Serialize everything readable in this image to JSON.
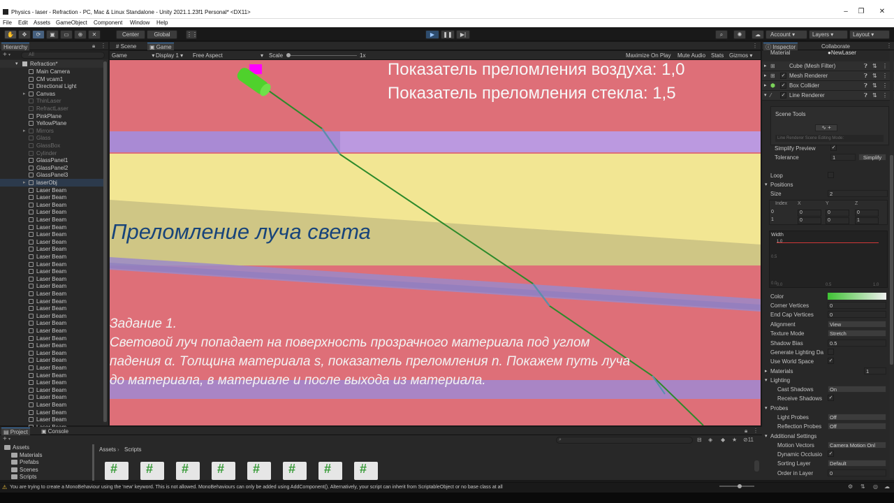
{
  "window": {
    "title": "Physics - laser - Refraction - PC, Mac & Linux Standalone - Unity 2021.1.23f1 Personal* <DX11>",
    "min": "–",
    "max": "❐",
    "close": "✕"
  },
  "menu": [
    "File",
    "Edit",
    "Assets",
    "GameObject",
    "Component",
    "Window",
    "Help"
  ],
  "toolbar": {
    "pivot_center": "Center",
    "pivot_global": "Global",
    "account": "Account",
    "layers": "Layers",
    "layout": "Layout"
  },
  "hierarchy": {
    "tab": "Hierarchy",
    "search_placeholder": "All",
    "scene": "Refraction*",
    "items": [
      {
        "label": "Main Camera",
        "dim": false,
        "arrow": ""
      },
      {
        "label": "CM vcam1",
        "dim": false,
        "arrow": ""
      },
      {
        "label": "Directional Light",
        "dim": false,
        "arrow": ""
      },
      {
        "label": "Canvas",
        "dim": false,
        "arrow": "▸"
      },
      {
        "label": "ThinLaser",
        "dim": true,
        "arrow": ""
      },
      {
        "label": "RefractLaser",
        "dim": true,
        "arrow": ""
      },
      {
        "label": "PinkPlane",
        "dim": false,
        "arrow": ""
      },
      {
        "label": "YellowPlane",
        "dim": false,
        "arrow": ""
      },
      {
        "label": "Mirrors",
        "dim": true,
        "arrow": "▸"
      },
      {
        "label": "Glass",
        "dim": true,
        "arrow": ""
      },
      {
        "label": "GlassBox",
        "dim": true,
        "arrow": ""
      },
      {
        "label": "Cylinder",
        "dim": true,
        "arrow": ""
      },
      {
        "label": "GlassPanel1",
        "dim": false,
        "arrow": ""
      },
      {
        "label": "GlassPanel2",
        "dim": false,
        "arrow": ""
      },
      {
        "label": "GlassPanel3",
        "dim": false,
        "arrow": ""
      },
      {
        "label": "laserObj",
        "dim": false,
        "arrow": "▸",
        "selected": true
      },
      {
        "label": "Laser Beam",
        "dim": false,
        "arrow": ""
      },
      {
        "label": "Laser Beam",
        "dim": false,
        "arrow": ""
      },
      {
        "label": "Laser Beam",
        "dim": false,
        "arrow": ""
      },
      {
        "label": "Laser Beam",
        "dim": false,
        "arrow": ""
      },
      {
        "label": "Laser Beam",
        "dim": false,
        "arrow": ""
      },
      {
        "label": "Laser Beam",
        "dim": false,
        "arrow": ""
      },
      {
        "label": "Laser Beam",
        "dim": false,
        "arrow": ""
      },
      {
        "label": "Laser Beam",
        "dim": false,
        "arrow": ""
      },
      {
        "label": "Laser Beam",
        "dim": false,
        "arrow": ""
      },
      {
        "label": "Laser Beam",
        "dim": false,
        "arrow": ""
      },
      {
        "label": "Laser Beam",
        "dim": false,
        "arrow": ""
      },
      {
        "label": "Laser Beam",
        "dim": false,
        "arrow": ""
      },
      {
        "label": "Laser Beam",
        "dim": false,
        "arrow": ""
      },
      {
        "label": "Laser Beam",
        "dim": false,
        "arrow": ""
      },
      {
        "label": "Laser Beam",
        "dim": false,
        "arrow": ""
      },
      {
        "label": "Laser Beam",
        "dim": false,
        "arrow": ""
      },
      {
        "label": "Laser Beam",
        "dim": false,
        "arrow": ""
      },
      {
        "label": "Laser Beam",
        "dim": false,
        "arrow": ""
      },
      {
        "label": "Laser Beam",
        "dim": false,
        "arrow": ""
      },
      {
        "label": "Laser Beam",
        "dim": false,
        "arrow": ""
      },
      {
        "label": "Laser Beam",
        "dim": false,
        "arrow": ""
      },
      {
        "label": "Laser Beam",
        "dim": false,
        "arrow": ""
      },
      {
        "label": "Laser Beam",
        "dim": false,
        "arrow": ""
      },
      {
        "label": "Laser Beam",
        "dim": false,
        "arrow": ""
      },
      {
        "label": "Laser Beam",
        "dim": false,
        "arrow": ""
      },
      {
        "label": "Laser Beam",
        "dim": false,
        "arrow": ""
      },
      {
        "label": "Laser Beam",
        "dim": false,
        "arrow": ""
      },
      {
        "label": "Laser Beam",
        "dim": false,
        "arrow": ""
      },
      {
        "label": "Laser Beam",
        "dim": false,
        "arrow": ""
      },
      {
        "label": "Laser Beam",
        "dim": false,
        "arrow": ""
      },
      {
        "label": "Laser Beam",
        "dim": false,
        "arrow": ""
      },
      {
        "label": "Laser Beam",
        "dim": false,
        "arrow": ""
      },
      {
        "label": "Laser Beam",
        "dim": false,
        "arrow": ""
      }
    ]
  },
  "game_view": {
    "tab_scene": "Scene",
    "tab_game": "Game",
    "display_mode": "Game",
    "display": "Display 1",
    "aspect": "Free Aspect",
    "scale_label": "Scale",
    "scale_value": "1x",
    "maximize": "Maximize On Play",
    "mute": "Mute Audio",
    "stats": "Stats",
    "gizmos": "Gizmos",
    "info_air": "Показатель преломления воздуха: 1,0",
    "info_glass": "Показатель преломления стекла: 1,5",
    "heading": "Преломление луча света",
    "task_title": "Задание 1.",
    "task_line1": "Световой луч попадает на поверхность прозрачного материала под углом",
    "task_line2": "падения α. Толщина материала s, показатель преломления n. Покажем путь луча",
    "task_line3": "до материала, в материале и после выхода из материала."
  },
  "inspector": {
    "tab_inspector": "Inspector",
    "tab_collab": "Collaborate",
    "material_label": "Material",
    "material_value": "NewLaser",
    "components": [
      "Cube (Mesh Filter)",
      "Mesh Renderer",
      "Box Collider",
      "Line Renderer"
    ],
    "scene_tools": "Scene Tools",
    "editing_mode": "Line Renderer Scene Editing Mode:",
    "simplify_preview": "Simplify Preview",
    "tolerance": "Tolerance",
    "tolerance_value": "1",
    "simplify_btn": "Simplify",
    "loop": "Loop",
    "positions": "Positions",
    "size_label": "Size",
    "size_value": "2",
    "pos_headers": [
      "Index",
      "X",
      "Y",
      "Z"
    ],
    "pos_rows": [
      [
        "0",
        "0",
        "0",
        "0"
      ],
      [
        "1",
        "0",
        "0",
        "1"
      ]
    ],
    "width_label": "Width",
    "width_curve_value": "1.0",
    "width_axis": [
      "0.5",
      "0.0",
      "0.0",
      "0.5",
      "1.0"
    ],
    "color_label": "Color",
    "fields": [
      {
        "label": "Corner Vertices",
        "value": "0",
        "type": "field"
      },
      {
        "label": "End Cap Vertices",
        "value": "0",
        "type": "field"
      },
      {
        "label": "Alignment",
        "value": "View",
        "type": "dd"
      },
      {
        "label": "Texture Mode",
        "value": "Stretch",
        "type": "dd"
      },
      {
        "label": "Shadow Bias",
        "value": "0.5",
        "type": "field"
      },
      {
        "label": "Generate Lighting Da",
        "value": "",
        "type": "check"
      },
      {
        "label": "Use World Space",
        "value": "✓",
        "type": "check"
      }
    ],
    "materials_label": "Materials",
    "materials_value": "1",
    "lighting_label": "Lighting",
    "cast_shadows": "Cast Shadows",
    "cast_shadows_value": "On",
    "receive_shadows": "Receive Shadows",
    "probes_label": "Probes",
    "light_probes": "Light Probes",
    "light_probes_value": "Off",
    "reflection_probes": "Reflection Probes",
    "reflection_probes_value": "Off",
    "additional_label": "Additional Settings",
    "motion_vectors": "Motion Vectors",
    "motion_vectors_value": "Camera Motion Onl",
    "dynamic_occlusion": "Dynamic Occlusio",
    "sorting_layer": "Sorting Layer",
    "sorting_layer_value": "Default",
    "order_in_layer": "Order in Layer",
    "order_in_layer_value": "0"
  },
  "project": {
    "tab_project": "Project",
    "tab_console": "Console",
    "tree": [
      "Assets",
      "Materials",
      "Prefabs",
      "Scenes",
      "Scripts"
    ],
    "breadcrumb_root": "Assets",
    "breadcrumb_current": "Scripts",
    "file_count": "11",
    "script_icon": "#"
  },
  "status": {
    "message": "You are trying to create a MonoBehaviour using the 'new' keyword.  This is not allowed.  MonoBehaviours can only be added using AddComponent(). Alternatively, your script can inherit from ScriptableObject or no base class at all"
  },
  "colors": {
    "pink": "#de6f78",
    "yellow": "#f2e693",
    "purple": "#a98ad4",
    "laser": "#2d8a2b",
    "laser_refract": "#5a8fb0",
    "cylinder": "#4fd12c",
    "magenta": "#ff00ff",
    "heading_blue": "#18447a",
    "accent": "#3a79bb"
  }
}
